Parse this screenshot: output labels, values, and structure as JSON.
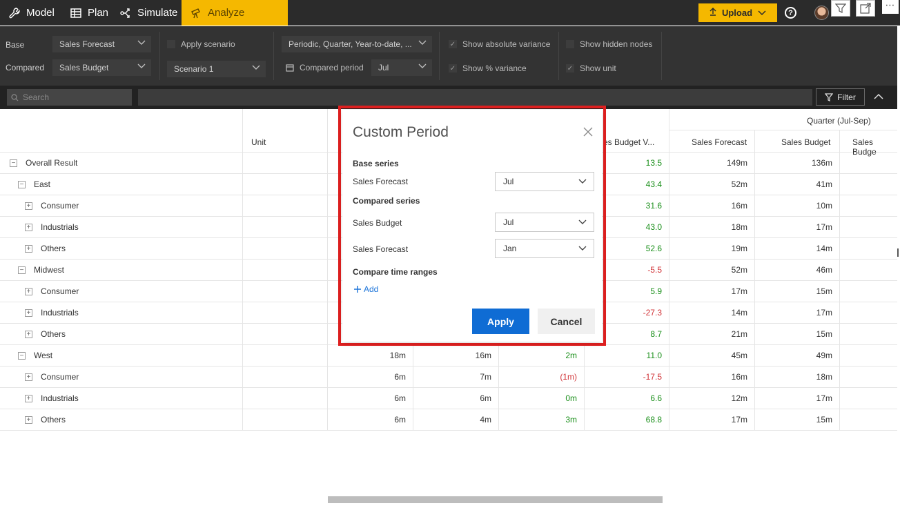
{
  "nav": {
    "tabs": [
      {
        "label": "Model",
        "icon": "wrench-icon"
      },
      {
        "label": "Plan",
        "icon": "table-icon"
      },
      {
        "label": "Simulate",
        "icon": "branch-icon"
      },
      {
        "label": "Analyze",
        "icon": "telescope-icon",
        "active": true
      }
    ],
    "upload_label": "Upload",
    "help_label": "?"
  },
  "settings": {
    "base_label": "Base",
    "base_value": "Sales Forecast",
    "compared_label": "Compared",
    "compared_value": "Sales Budget",
    "apply_scenario_label": "Apply scenario",
    "scenario_value": "Scenario 1",
    "period_value": "Periodic, Quarter, Year-to-date, ...",
    "compared_period_label": "Compared period",
    "compared_period_value": "Jul",
    "show_abs_variance_label": "Show absolute variance",
    "show_pct_variance_label": "Show % variance",
    "show_hidden_nodes_label": "Show hidden nodes",
    "show_unit_label": "Show unit"
  },
  "search": {
    "placeholder": "Search",
    "filter_label": "Filter"
  },
  "grid": {
    "group_header": "Quarter (Jul-Sep)",
    "columns": {
      "unit": "Unit",
      "col4": "es Budget V...",
      "sales_forecast": "Sales Forecast",
      "sales_budget": "Sales Budget",
      "sales_budge_trunc": "Sales Budge"
    },
    "rows": [
      {
        "label": "Overall Result",
        "toggle": "−",
        "c1": "",
        "c2": "",
        "c3": "",
        "c4": "13.5",
        "c5": "149m",
        "c6": "136m"
      },
      {
        "label": "East",
        "toggle": "−",
        "c1": "",
        "c2": "",
        "c3": "",
        "c4": "43.4",
        "c5": "52m",
        "c6": "41m"
      },
      {
        "label": "Consumer",
        "toggle": "+",
        "c1": "",
        "c2": "",
        "c3": "",
        "c4": "31.6",
        "c5": "16m",
        "c6": "10m"
      },
      {
        "label": "Industrials",
        "toggle": "+",
        "c1": "",
        "c2": "",
        "c3": "",
        "c4": "43.0",
        "c5": "18m",
        "c6": "17m"
      },
      {
        "label": "Others",
        "toggle": "+",
        "c1": "",
        "c2": "",
        "c3": "",
        "c4": "52.6",
        "c5": "19m",
        "c6": "14m"
      },
      {
        "label": "Midwest",
        "toggle": "−",
        "c1": "",
        "c2": "",
        "c3": "",
        "c4": "-5.5",
        "c5": "52m",
        "c6": "46m"
      },
      {
        "label": "Consumer",
        "toggle": "+",
        "c1": "",
        "c2": "",
        "c3": "",
        "c4": "5.9",
        "c5": "17m",
        "c6": "15m"
      },
      {
        "label": "Industrials",
        "toggle": "+",
        "c1": "",
        "c2": "",
        "c3": "",
        "c4": "-27.3",
        "c5": "14m",
        "c6": "17m"
      },
      {
        "label": "Others",
        "toggle": "+",
        "c1": "",
        "c2": "",
        "c3": "",
        "c4": "8.7",
        "c5": "21m",
        "c6": "15m"
      },
      {
        "label": "West",
        "toggle": "−",
        "c1": "18m",
        "c2": "16m",
        "c3": "2m",
        "c4": "11.0",
        "c5": "45m",
        "c6": "49m"
      },
      {
        "label": "Consumer",
        "toggle": "+",
        "c1": "6m",
        "c2": "7m",
        "c3": "(1m)",
        "c4": "-17.5",
        "c5": "16m",
        "c6": "18m"
      },
      {
        "label": "Industrials",
        "toggle": "+",
        "c1": "6m",
        "c2": "6m",
        "c3": "0m",
        "c4": "6.6",
        "c5": "12m",
        "c6": "17m"
      },
      {
        "label": "Others",
        "toggle": "+",
        "c1": "6m",
        "c2": "4m",
        "c3": "3m",
        "c4": "68.8",
        "c5": "17m",
        "c6": "15m"
      }
    ]
  },
  "modal": {
    "title": "Custom Period",
    "base_series_heading": "Base series",
    "base_series_label": "Sales Forecast",
    "base_series_value": "Jul",
    "compared_series_heading": "Compared series",
    "compared_1_label": "Sales Budget",
    "compared_1_value": "Jul",
    "compared_2_label": "Sales Forecast",
    "compared_2_value": "Jan",
    "compare_ranges_heading": "Compare time ranges",
    "add_label": "Add",
    "apply_label": "Apply",
    "cancel_label": "Cancel"
  },
  "colors": {
    "accent": "#f5b800",
    "primary_button": "#0f6cd4",
    "positive": "#1a8f1a",
    "negative": "#d13438",
    "highlight_frame": "#e02020"
  }
}
